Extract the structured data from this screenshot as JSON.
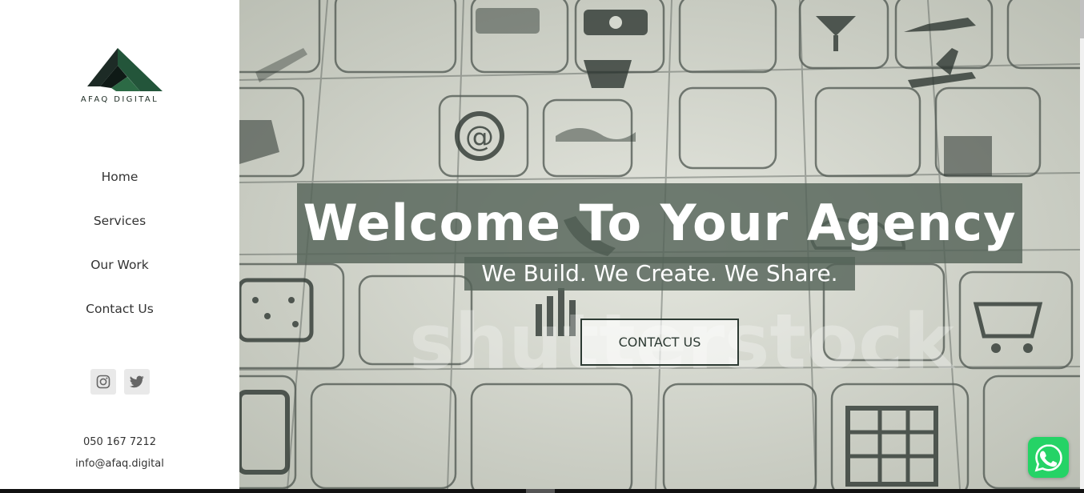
{
  "brand": {
    "name": "AFAQ DIGITAL",
    "color": "#1e3a2a"
  },
  "nav": {
    "items": [
      {
        "label": "Home"
      },
      {
        "label": "Services"
      },
      {
        "label": "Our Work"
      },
      {
        "label": "Contact Us"
      }
    ]
  },
  "social": {
    "icons": [
      "instagram-icon",
      "twitter-icon"
    ]
  },
  "contact": {
    "phone": "050 167 7212",
    "email": "info@afaq.digital"
  },
  "hero": {
    "headline": "Welcome To Your Agency",
    "subheadline": "We Build. We Create. We Share.",
    "cta_label": "CONTACT US",
    "watermark": "shutterstock",
    "overlay_color": "#546358"
  },
  "whatsapp": {
    "icon": "whatsapp-icon",
    "color": "#25d366"
  }
}
